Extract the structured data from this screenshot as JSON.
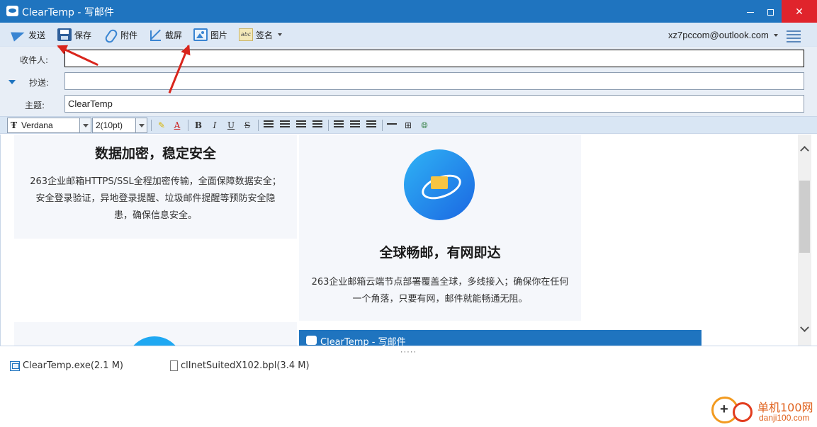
{
  "window": {
    "title": "ClearTemp - 写邮件"
  },
  "toolbar": {
    "send": "发送",
    "save": "保存",
    "attach": "附件",
    "screenshot": "截屏",
    "image": "图片",
    "signature": "签名",
    "account": "xz7pccom@outlook.com"
  },
  "header": {
    "to_label": "收件人:",
    "to_value": "",
    "cc_label": "抄送:",
    "cc_value": "",
    "subject_label": "主题:",
    "subject_value": "ClearTemp"
  },
  "format": {
    "font": "Verdana",
    "size": "2(10pt)"
  },
  "content": {
    "card1_title": "数据加密，稳定安全",
    "card1_text": "263企业邮箱HTTPS/SSL全程加密传输，全面保障数据安全；安全登录验证，异地登录提醒、垃圾邮件提醒等预防安全隐患，确保信息安全。",
    "card2_title": "全球畅邮，有网即达",
    "card2_text": "263企业邮箱云端节点部署覆盖全球，多线接入；确保你在任何一个角落，只要有网，邮件就能畅通无阻。",
    "nested_title": "ClearTemp - 写邮件"
  },
  "splitter": "·····",
  "attachments": [
    {
      "name": "ClearTemp.exe(2.1 M)",
      "icon": "exe-file-icon"
    },
    {
      "name": "clInetSuitedX102.bpl(3.4 M)",
      "icon": "file-icon"
    }
  ],
  "watermark": {
    "text1": "单机100网",
    "text2": "danji100.com"
  },
  "colors": {
    "titlebar": "#1f74bf",
    "close": "#e0242c",
    "accent_arrow": "#d9251c"
  }
}
